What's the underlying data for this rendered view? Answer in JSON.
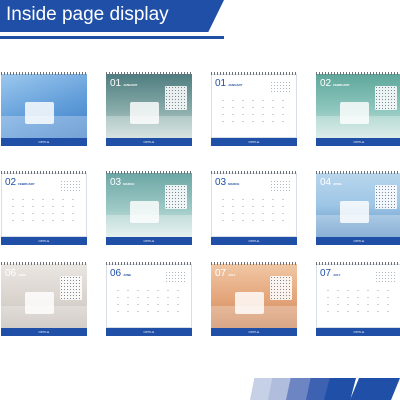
{
  "page": {
    "title": "Inside page display"
  },
  "brand": "OPPLE",
  "colors": {
    "accent": "#1f4fa6"
  },
  "cards": [
    {
      "month_num": "",
      "month_name": "",
      "kind": "cover",
      "bg": "linear-gradient(160deg,#9cc8ee 0%,#5d9ad8 60%,#3f7ec6 100%)"
    },
    {
      "month_num": "01",
      "month_name": "JANUARY",
      "kind": "photo",
      "bg": "linear-gradient(180deg,#4f7d80 0%,#86aaa8 55%,#c7d8d5 100%)"
    },
    {
      "month_num": "01",
      "month_name": "JANUARY",
      "kind": "calendar"
    },
    {
      "month_num": "02",
      "month_name": "FEBRUARY",
      "kind": "photo",
      "bg": "linear-gradient(180deg,#5fa79b 0%,#8dc6bd 55%,#cfe6e1 100%)"
    },
    {
      "month_num": "02",
      "month_name": "FEBRUARY",
      "kind": "calendar"
    },
    {
      "month_num": "03",
      "month_name": "MARCH",
      "kind": "photo",
      "bg": "linear-gradient(180deg,#6da7a6 0%,#9cc8c4 55%,#dcecea 100%)"
    },
    {
      "month_num": "03",
      "month_name": "MARCH",
      "kind": "calendar"
    },
    {
      "month_num": "04",
      "month_name": "APRIL",
      "kind": "photo",
      "bg": "linear-gradient(180deg,#b8d6ec 0%,#9ec6e6 50%,#5f93c6 100%)"
    },
    {
      "month_num": "06",
      "month_name": "JUNE",
      "kind": "photo",
      "bg": "linear-gradient(180deg,#eae6e2 0%,#d8d2cc 60%,#c2bbb4 100%)"
    },
    {
      "month_num": "06",
      "month_name": "JUNE",
      "kind": "calendar"
    },
    {
      "month_num": "07",
      "month_name": "JULY",
      "kind": "photo",
      "bg": "linear-gradient(180deg,#f0c7a4 0%,#e4a57a 55%,#c98559 100%)"
    },
    {
      "month_num": "07",
      "month_name": "JULY",
      "kind": "calendar"
    }
  ]
}
